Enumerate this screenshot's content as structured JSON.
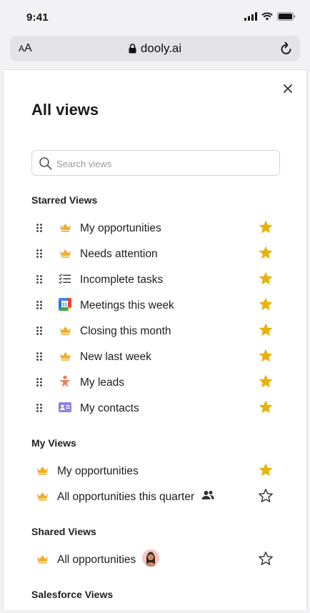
{
  "status": {
    "time": "9:41"
  },
  "browser": {
    "text_size_small": "A",
    "text_size_large": "A",
    "url": "dooly.ai"
  },
  "panel": {
    "title": "All views",
    "search_placeholder": "Search views",
    "starred": {
      "heading": "Starred Views",
      "items": [
        {
          "label": "My opportunities",
          "icon": "crown-icon",
          "starred": true
        },
        {
          "label": "Needs attention",
          "icon": "crown-icon",
          "starred": true
        },
        {
          "label": "Incomplete tasks",
          "icon": "checklist-icon",
          "starred": true
        },
        {
          "label": "Meetings this week",
          "icon": "calendar-icon",
          "starred": true
        },
        {
          "label": "Closing this month",
          "icon": "crown-icon",
          "starred": true
        },
        {
          "label": "New last week",
          "icon": "crown-icon",
          "starred": true
        },
        {
          "label": "My leads",
          "icon": "person-star-icon",
          "starred": true
        },
        {
          "label": "My contacts",
          "icon": "contact-card-icon",
          "starred": true
        }
      ]
    },
    "my_views": {
      "heading": "My Views",
      "items": [
        {
          "label": "My opportunities",
          "icon": "crown-icon",
          "starred": true
        },
        {
          "label": "All opportunities this quarter",
          "icon": "crown-icon",
          "starred": false,
          "shared_icon": "people-icon"
        }
      ]
    },
    "shared_views": {
      "heading": "Shared Views",
      "items": [
        {
          "label": "All opportunities",
          "icon": "crown-icon",
          "starred": false,
          "owner_icon": "avatar"
        }
      ]
    },
    "salesforce_views": {
      "heading": "Salesforce Views"
    }
  },
  "colors": {
    "star_filled": "#e9b10c",
    "crown": "#f0ad2c",
    "calendar_blue": "#1a73e8",
    "contact_purple": "#8b84e0",
    "lead_orange": "#ef7e5b"
  }
}
